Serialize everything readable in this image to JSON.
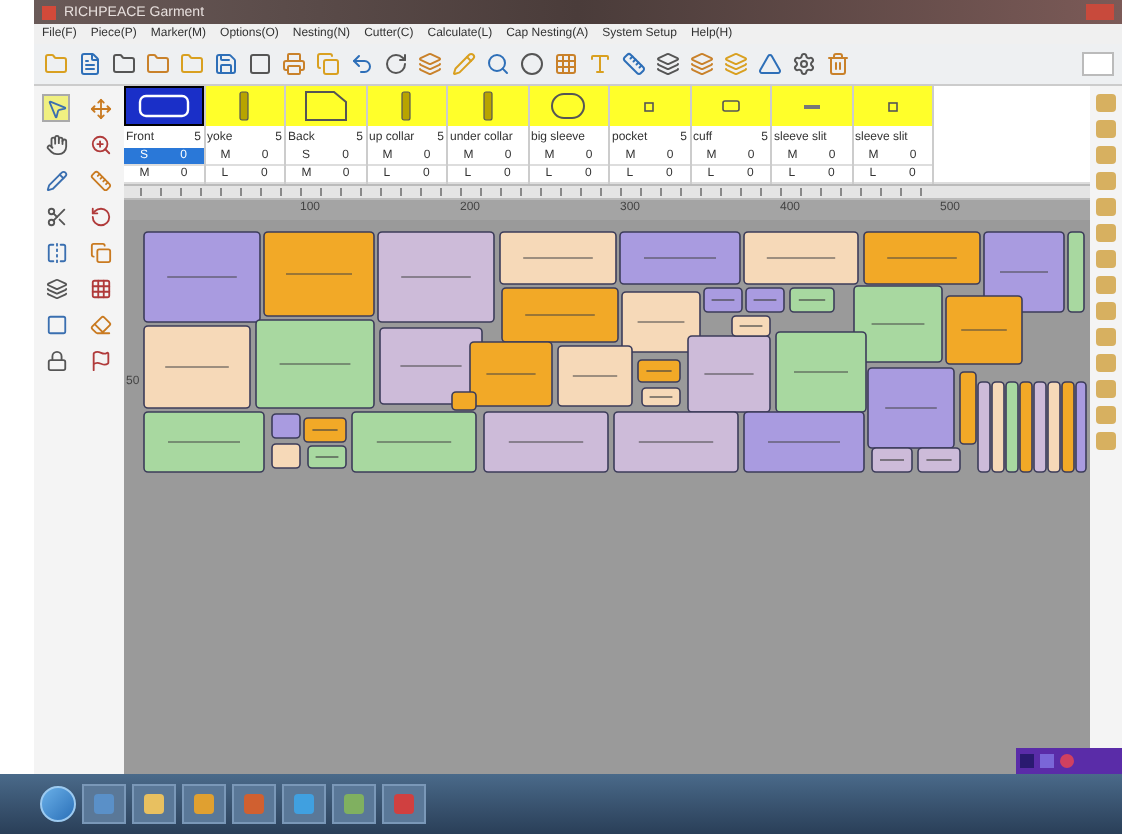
{
  "window": {
    "title": "RICHPEACE Garment"
  },
  "menu": [
    "File(F)",
    "Piece(P)",
    "Marker(M)",
    "Options(O)",
    "Nesting(N)",
    "Cutter(C)",
    "Calculate(L)",
    "Cap Nesting(A)",
    "System Setup",
    "Help(H)"
  ],
  "pieces": [
    {
      "label": "Front",
      "count": "5",
      "selected": true,
      "sizes": [
        {
          "size": "S",
          "qty": "0",
          "selected": true
        },
        {
          "size": "M",
          "qty": "0",
          "selected": false
        }
      ]
    },
    {
      "label": "yoke",
      "count": "5",
      "selected": false,
      "sizes": [
        {
          "size": "M",
          "qty": "0",
          "selected": false
        },
        {
          "size": "L",
          "qty": "0",
          "selected": false
        }
      ]
    },
    {
      "label": "Back",
      "count": "5",
      "selected": false,
      "sizes": [
        {
          "size": "S",
          "qty": "0",
          "selected": false
        },
        {
          "size": "M",
          "qty": "0",
          "selected": false
        }
      ]
    },
    {
      "label": "up collar",
      "count": "5",
      "selected": false,
      "sizes": [
        {
          "size": "M",
          "qty": "0",
          "selected": false
        },
        {
          "size": "L",
          "qty": "0",
          "selected": false
        }
      ]
    },
    {
      "label": "under collar",
      "selected": false,
      "sizes": [
        {
          "size": "M",
          "qty": "0",
          "selected": false
        },
        {
          "size": "L",
          "qty": "0",
          "selected": false
        }
      ]
    },
    {
      "label": "big sleeve",
      "selected": false,
      "sizes": [
        {
          "size": "M",
          "qty": "0",
          "selected": false
        },
        {
          "size": "L",
          "qty": "0",
          "selected": false
        }
      ]
    },
    {
      "label": "pocket",
      "count": "5",
      "selected": false,
      "sizes": [
        {
          "size": "M",
          "qty": "0",
          "selected": false
        },
        {
          "size": "L",
          "qty": "0",
          "selected": false
        }
      ]
    },
    {
      "label": "cuff",
      "count": "5",
      "selected": false,
      "sizes": [
        {
          "size": "M",
          "qty": "0",
          "selected": false
        },
        {
          "size": "L",
          "qty": "0",
          "selected": false
        }
      ]
    },
    {
      "label": "sleeve slit",
      "selected": false,
      "sizes": [
        {
          "size": "M",
          "qty": "0",
          "selected": false
        },
        {
          "size": "L",
          "qty": "0",
          "selected": false
        }
      ]
    },
    {
      "label": "sleeve slit",
      "selected": false,
      "sizes": [
        {
          "size": "M",
          "qty": "0",
          "selected": false
        },
        {
          "size": "L",
          "qty": "0",
          "selected": false
        }
      ]
    }
  ],
  "ruler": {
    "marks": [
      "100",
      "200",
      "300",
      "400",
      "500"
    ],
    "side_marks": [
      "50"
    ]
  }
}
